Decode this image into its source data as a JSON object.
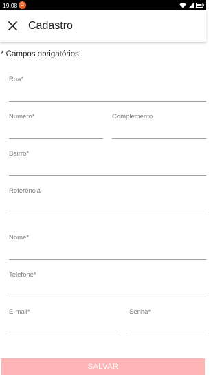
{
  "status_bar": {
    "time": "19:08",
    "notification_letter": "G"
  },
  "app_bar": {
    "title": "Cadastro"
  },
  "form": {
    "required_note": "* Campos obrigatórios",
    "fields": {
      "rua": {
        "label": "Rua*",
        "value": ""
      },
      "numero": {
        "label": "Numero*",
        "value": ""
      },
      "complemento": {
        "label": "Complemento",
        "value": ""
      },
      "bairro": {
        "label": "Bairro*",
        "value": ""
      },
      "referencia": {
        "label": "Referência",
        "value": ""
      },
      "nome": {
        "label": "Nome*",
        "value": ""
      },
      "telefone": {
        "label": "Telefone*",
        "value": ""
      },
      "email": {
        "label": "E-mail*",
        "value": ""
      },
      "senha": {
        "label": "Senha*",
        "value": ""
      }
    },
    "save_label": "SALVAR"
  },
  "colors": {
    "accent": "#ffb5b5",
    "notification": "#e8652b"
  }
}
